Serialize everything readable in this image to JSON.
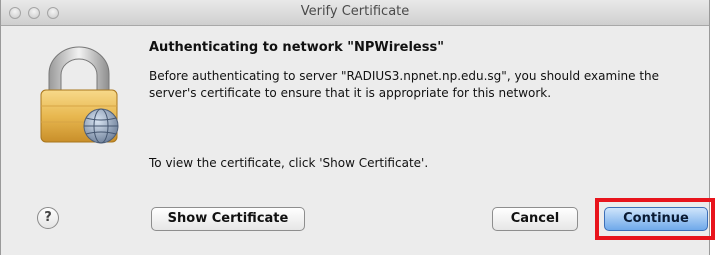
{
  "window": {
    "title": "Verify Certificate"
  },
  "dialog": {
    "heading": "Authenticating to network \"NPWireless\"",
    "message": "Before authenticating to server \"RADIUS3.npnet.np.edu.sg\", you should examine the server's certificate to ensure that it is appropriate for this network.",
    "hint": "To view the certificate, click 'Show Certificate'."
  },
  "buttons": {
    "help": "?",
    "show_certificate": "Show Certificate",
    "cancel": "Cancel",
    "continue": "Continue"
  },
  "icons": {
    "main": "lock-globe-icon",
    "help": "help-icon"
  },
  "colors": {
    "highlight": "#e8141c",
    "default_button": "#6fa9ea"
  }
}
